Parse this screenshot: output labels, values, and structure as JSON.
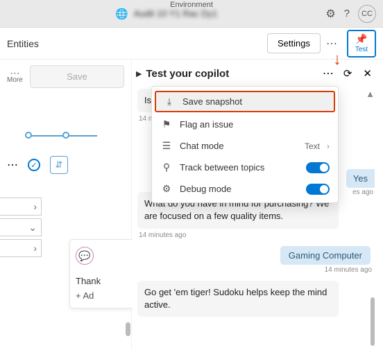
{
  "topbar": {
    "env_label": "Environment",
    "env_text": "Audit 10 Y1 Rac Dy1",
    "avatar": "CC"
  },
  "subbar": {
    "title": "Entities",
    "settings": "Settings",
    "test": "Test"
  },
  "leftpane": {
    "more": "More",
    "save": "Save",
    "card_text": "Thank",
    "card_add": "+  Ad"
  },
  "testpane": {
    "title": "Test your copilot"
  },
  "menu": {
    "save_snapshot": "Save snapshot",
    "flag_issue": "Flag an issue",
    "chat_mode": "Chat mode",
    "chat_mode_val": "Text",
    "track": "Track between topics",
    "debug": "Debug mode"
  },
  "chat": {
    "m1": "Is that",
    "t1": "14 minutes ago",
    "m2": "What do you have in mind for purchasing? We are focused on a few quality items.",
    "t2": "14 minutes ago",
    "user1": "Gaming Computer",
    "t3": "14 minutes ago",
    "m3": "Go get 'em tiger! Sudoku helps keep the mind active.",
    "yes": "Yes",
    "yes_ts": "es ago"
  }
}
